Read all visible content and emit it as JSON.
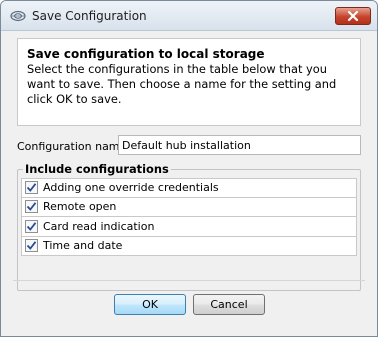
{
  "window": {
    "title": "Save Configuration",
    "icon": "network-hub-icon"
  },
  "info": {
    "title": "Save configuration to local storage",
    "description": "Select the configurations in the table below that you want to save. Then choose a name for the setting and click OK to save."
  },
  "config_name": {
    "label": "Configuration name",
    "value": "Default hub installation"
  },
  "include": {
    "title": "Include configurations",
    "items": [
      {
        "label": "Adding one override credentials",
        "checked": true
      },
      {
        "label": "Remote open",
        "checked": true
      },
      {
        "label": "Card read indication",
        "checked": true
      },
      {
        "label": "Time and date",
        "checked": true
      }
    ]
  },
  "buttons": {
    "ok": "OK",
    "cancel": "Cancel"
  },
  "colors": {
    "ok_border": "#3c7fb1",
    "close_button": "#c6452d",
    "check": "#2a4d8f"
  }
}
